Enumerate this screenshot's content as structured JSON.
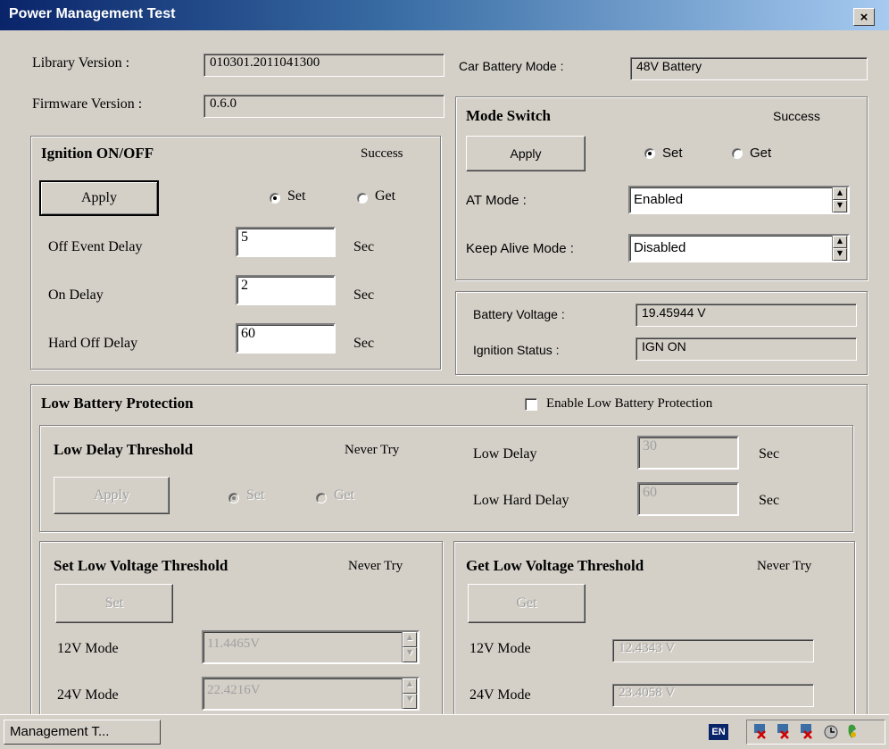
{
  "window": {
    "title": "Power Management Test",
    "close": "×"
  },
  "info": {
    "library_label": "Library Version :",
    "library_value": "010301.2011041300",
    "firmware_label": "Firmware Version :",
    "firmware_value": "0.6.0",
    "car_battery_label": "Car Battery Mode :",
    "car_battery_value": "48V Battery"
  },
  "ignition": {
    "title": "Ignition ON/OFF",
    "status": "Success",
    "apply": "Apply",
    "set": "Set",
    "get": "Get",
    "set_selected": true,
    "off_event_label": "Off Event Delay",
    "off_event_value": "5",
    "on_delay_label": "On Delay",
    "on_delay_value": "2",
    "hard_off_label": "Hard Off Delay",
    "hard_off_value": "60",
    "unit": "Sec"
  },
  "mode_switch": {
    "title": "Mode Switch",
    "status": "Success",
    "apply": "Apply",
    "set": "Set",
    "get": "Get",
    "set_selected": true,
    "at_label": "AT Mode :",
    "at_value": "Enabled",
    "keep_alive_label": "Keep Alive Mode :",
    "keep_alive_value": "Disabled"
  },
  "battery": {
    "voltage_label": "Battery Voltage :",
    "voltage_value": "19.45944 V",
    "ignition_label": "Ignition Status :",
    "ignition_value": "IGN ON"
  },
  "low_battery": {
    "title": "Low Battery Protection",
    "enable_label": "Enable Low Battery Protection",
    "enabled": false,
    "delay": {
      "title": "Low Delay Threshold",
      "status": "Never Try",
      "apply": "Apply",
      "set": "Set",
      "get": "Get",
      "low_delay_label": "Low Delay",
      "low_delay_value": "30",
      "low_hard_label": "Low Hard Delay",
      "low_hard_value": "60",
      "unit": "Sec"
    },
    "set_voltage": {
      "title": "Set Low Voltage Threshold",
      "status": "Never Try",
      "button": "Set",
      "v12_label": "12V Mode",
      "v12_value": "11.4465V",
      "v24_label": "24V Mode",
      "v24_value": "22.4216V"
    },
    "get_voltage": {
      "title": "Get Low Voltage Threshold",
      "status": "Never Try",
      "button": "Get",
      "v12_label": "12V Mode",
      "v12_value": "12.4343 V",
      "v24_label": "24V Mode",
      "v24_value": "23.4058 V"
    }
  },
  "taskbar": {
    "task": "Management T...",
    "lang": "EN"
  }
}
